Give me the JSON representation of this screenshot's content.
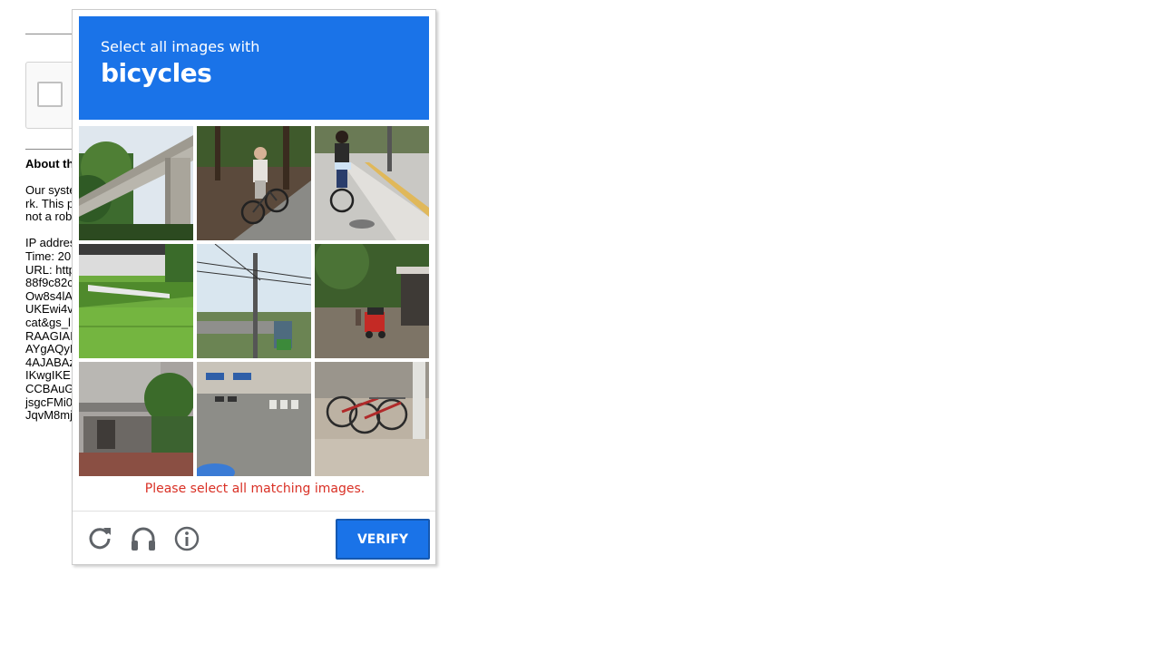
{
  "background_page": {
    "about_title": "About th",
    "lines": [
      "Our syste",
      "rk. This p",
      "not a rob",
      "",
      "IP addres",
      "Time: 20",
      "URL: http",
      "88f9c82c",
      "Ow8s4lA",
      "UKEwi4v",
      "cat&gs_l",
      "RAAGIAI",
      "AYgAQyI",
      "4AJABAz",
      "IKwgIKEI",
      "CCBAuG",
      "jsgcFMi0",
      "JqvM8mj"
    ]
  },
  "challenge": {
    "instruction_prefix": "Select all images with",
    "target_object": "bicycles",
    "error_message": "Please select all matching images.",
    "verify_label": "VERIFY",
    "accent_color": "#1a73e8",
    "error_color": "#d93025",
    "tiles": [
      {
        "subject": "overpass-bridge-trees"
      },
      {
        "subject": "man-riding-bicycle-path"
      },
      {
        "subject": "woman-riding-bicycle-sidewalk"
      },
      {
        "subject": "grass-roof-building"
      },
      {
        "subject": "railway-overhead-wires"
      },
      {
        "subject": "street-with-red-tuk-tuk"
      },
      {
        "subject": "building-entrance-trees"
      },
      {
        "subject": "crosswalk-street-scooters"
      },
      {
        "subject": "parked-bicycles-rack"
      }
    ],
    "footer_icons": [
      "reload-icon",
      "audio-headphones-icon",
      "info-icon"
    ]
  }
}
